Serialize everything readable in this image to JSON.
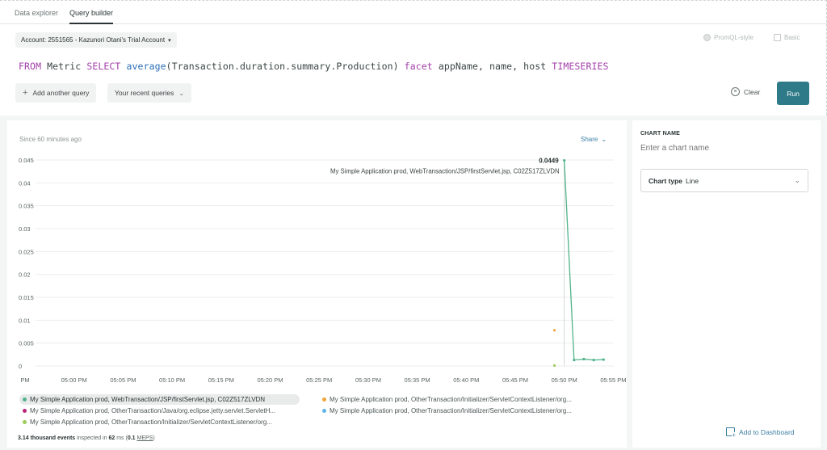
{
  "tabs": [
    {
      "label": "Data explorer",
      "active": false
    },
    {
      "label": "Query builder",
      "active": true
    }
  ],
  "account": {
    "label": "Account: 2551565 - Kazunori Otani's Trial Account"
  },
  "modes": {
    "promql": "PromQL-style",
    "basic": "Basic"
  },
  "query": {
    "kw_from": "FROM",
    "t1": " Metric ",
    "kw_select": "SELECT",
    "sp1": " ",
    "fn": "average",
    "t2": "(Transaction.duration.summary.Production) ",
    "kw_facet": "facet",
    "t3": " appName, name, host ",
    "kw_ts": "TIMESERIES"
  },
  "buttons": {
    "add_query": "Add another query",
    "recent": "Your recent queries",
    "clear": "Clear",
    "run": "Run",
    "share": "Share",
    "add_dashboard": "Add to Dashboard"
  },
  "chart_header": {
    "since": "Since 60 minutes ago"
  },
  "sidebar": {
    "chart_name_label": "CHART NAME",
    "chart_name_placeholder": "Enter a chart name",
    "chart_type_label": "Chart type",
    "chart_type_value": "Line"
  },
  "footer": {
    "events": "3.14 thousand events",
    "inspected": " inspected in ",
    "ms": "62",
    "ms_unit": " ms (",
    "meps": "0.1",
    "meps_unit": "MEPS",
    "close": ")"
  },
  "colors": {
    "series1": "#51b38a",
    "series2": "#f0a53a",
    "series3": "#b8257a",
    "series4": "#5fb4e6",
    "series5": "#9ccb5a",
    "run": "#2f7a88",
    "link": "#3d7fa4"
  },
  "chart_data": {
    "type": "line",
    "ylim": [
      0,
      0.045
    ],
    "y_ticks": [
      "0",
      "0.005",
      "0.01",
      "0.015",
      "0.02",
      "0.025",
      "0.03",
      "0.035",
      "0.04",
      "0.045"
    ],
    "x_ticks": [
      "PM",
      "05:00 PM",
      "05:05 PM",
      "05:10 PM",
      "05:15 PM",
      "05:20 PM",
      "05:25 PM",
      "05:30 PM",
      "05:35 PM",
      "05:40 PM",
      "05:45 PM",
      "05:50 PM",
      "05:55 PM"
    ],
    "tooltip": {
      "value": "0.0449",
      "series": "My Simple Application prod, WebTransaction/JSP/firstServlet.jsp, C02Z517ZLVDN"
    },
    "series": [
      {
        "name": "My Simple Application prod, WebTransaction/JSP/firstServlet.jsp, C02Z517ZLVDN",
        "color": "#51b38a",
        "points": [
          [
            "05:50 PM",
            0.0449
          ],
          [
            "05:51 PM",
            0.0013
          ],
          [
            "05:52 PM",
            0.0015
          ],
          [
            "05:53 PM",
            0.0013
          ],
          [
            "05:54 PM",
            0.0014
          ]
        ]
      },
      {
        "name": "My Simple Application prod, OtherTransaction/Initializer/ServletContextListener/org...",
        "color": "#f0a53a",
        "points": [
          [
            "05:49 PM",
            0.0078
          ]
        ]
      },
      {
        "name": "My Simple Application prod, OtherTransaction/Java/org.eclipse.jetty.servlet.ServletH...",
        "color": "#b8257a",
        "points": []
      },
      {
        "name": "My Simple Application prod, OtherTransaction/Initializer/ServletContextListener/org...",
        "color": "#5fb4e6",
        "points": []
      },
      {
        "name": "My Simple Application prod, OtherTransaction/Initializer/ServletContextListener/org...",
        "color": "#9ccb5a",
        "points": [
          [
            "05:49 PM",
            0.0001
          ]
        ]
      }
    ]
  }
}
